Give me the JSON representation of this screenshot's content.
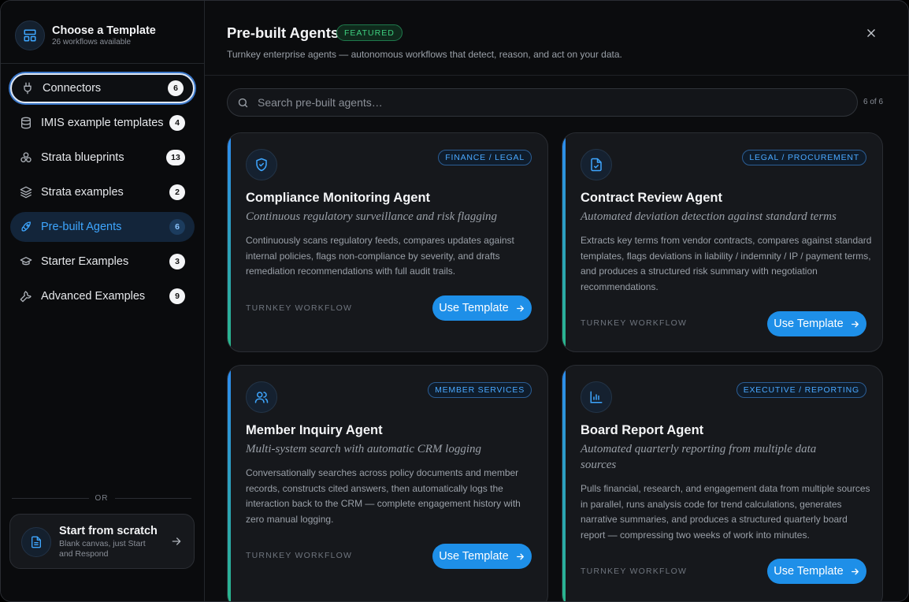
{
  "sidebar": {
    "title": "Choose a Template",
    "subtitle": "26 workflows available",
    "items": [
      {
        "label": "Connectors",
        "count": "6"
      },
      {
        "label": "IMIS example templates",
        "count": "4"
      },
      {
        "label": "Strata blueprints",
        "count": "13"
      },
      {
        "label": "Strata examples",
        "count": "2"
      },
      {
        "label": "Pre-built Agents",
        "count": "6"
      },
      {
        "label": "Starter Examples",
        "count": "3"
      },
      {
        "label": "Advanced Examples",
        "count": "9"
      }
    ],
    "or_text": "OR",
    "scratch": {
      "title": "Start from scratch",
      "subtitle": "Blank canvas, just Start and Respond"
    }
  },
  "header": {
    "title": "Pre-built Agents",
    "badge": "FEATURED",
    "subtitle": "Turnkey enterprise agents — autonomous workflows that detect, reason, and act on your data."
  },
  "search": {
    "placeholder": "Search pre-built agents…",
    "value": "",
    "count": "6 of 6"
  },
  "cards": [
    {
      "tag": "FINANCE / LEGAL",
      "title": "Compliance Monitoring Agent",
      "subtitle": "Continuous regulatory surveillance and risk flagging",
      "description": "Continuously scans regulatory feeds, compares updates against internal policies, flags non-compliance by severity, and drafts remediation recommendations with full audit trails.",
      "footer": "TURNKEY WORKFLOW",
      "button": "Use Template",
      "icon": "shield-icon"
    },
    {
      "tag": "LEGAL / PROCUREMENT",
      "title": "Contract Review Agent",
      "subtitle": "Automated deviation detection against standard terms",
      "description": "Extracts key terms from vendor contracts, compares against standard templates, flags deviations in liability / indemnity / IP / payment terms, and produces a structured risk summary with negotiation recommendations.",
      "footer": "TURNKEY WORKFLOW",
      "button": "Use Template",
      "icon": "document-check-icon"
    },
    {
      "tag": "MEMBER SERVICES",
      "title": "Member Inquiry Agent",
      "subtitle": "Multi-system search with automatic CRM logging",
      "description": "Conversationally searches across policy documents and member records, constructs cited answers, then automatically logs the interaction back to the CRM — complete engagement history with zero manual logging.",
      "footer": "TURNKEY WORKFLOW",
      "button": "Use Template",
      "icon": "users-icon"
    },
    {
      "tag": "EXECUTIVE / REPORTING",
      "title": "Board Report Agent",
      "subtitle": "Automated quarterly reporting from multiple data sources",
      "description": "Pulls financial, research, and engagement data from multiple sources in parallel, runs analysis code for trend calculations, generates narrative summaries, and produces a structured quarterly board report — compressing two weeks of work into minutes.",
      "footer": "TURNKEY WORKFLOW",
      "button": "Use Template",
      "icon": "bar-chart-icon"
    }
  ],
  "colors": {
    "accent": "#1e8fe8",
    "active_text": "#3ea6ff",
    "featured_green": "#3ecf7f"
  }
}
